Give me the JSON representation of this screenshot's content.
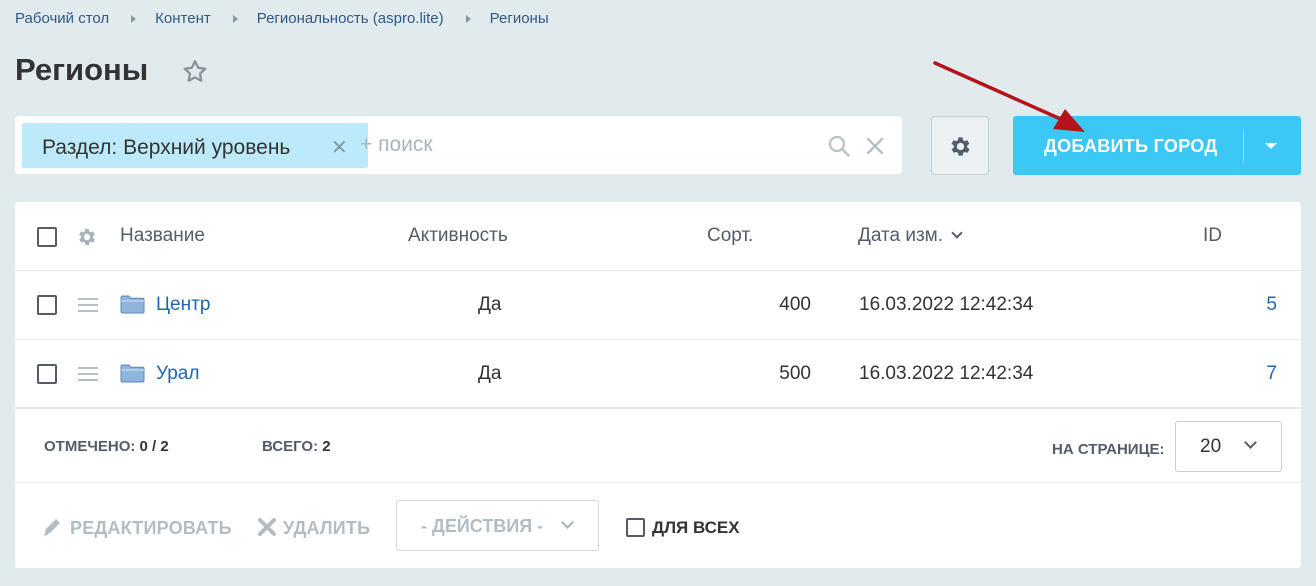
{
  "breadcrumb": [
    "Рабочий стол",
    "Контент",
    "Региональность (aspro.lite)",
    "Регионы"
  ],
  "page_title": "Регионы",
  "filter": {
    "tag_label": "Раздел: Верхний уровень",
    "search_placeholder": "+ поиск"
  },
  "add_button_label": "ДОБАВИТЬ ГОРОД",
  "columns": {
    "name": "Название",
    "active": "Активность",
    "sort": "Сорт.",
    "date": "Дата изм.",
    "id": "ID"
  },
  "rows": [
    {
      "name": "Центр",
      "active": "Да",
      "sort": "400",
      "date": "16.03.2022 12:42:34",
      "id": "5"
    },
    {
      "name": "Урал",
      "active": "Да",
      "sort": "500",
      "date": "16.03.2022 12:42:34",
      "id": "7"
    }
  ],
  "footer": {
    "checked_label": "ОТМЕЧЕНО:",
    "checked_value": "0 / 2",
    "total_label": "ВСЕГО:",
    "total_value": "2",
    "per_page_label": "НА СТРАНИЦЕ:",
    "per_page_value": "20"
  },
  "actions": {
    "edit_label": "РЕДАКТИРОВАТЬ",
    "delete_label": "УДАЛИТЬ",
    "actions_select": "- ДЕЙСТВИЯ -",
    "for_all_label": "ДЛЯ ВСЕХ"
  },
  "colors": {
    "background": "#e1eaed",
    "accent": "#3bc8f5",
    "filter_tag": "#bdeafb",
    "link": "#2067b0",
    "annotation_arrow": "#b5121b"
  },
  "icons": [
    "star-icon",
    "search-icon",
    "close-icon",
    "gear-icon",
    "chevron-down-icon",
    "drag-handle-icon",
    "folder-icon",
    "pencil-icon",
    "delete-icon"
  ]
}
